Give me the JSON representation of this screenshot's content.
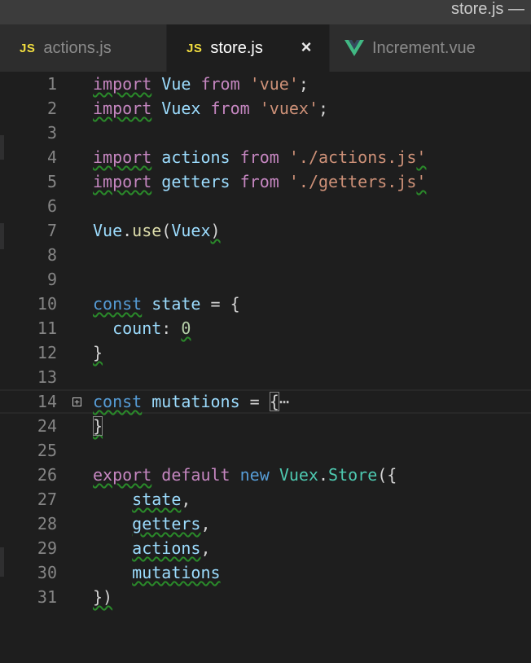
{
  "window": {
    "title": "store.js —"
  },
  "tabs": [
    {
      "icon": "js-file-icon",
      "icon_text": "JS",
      "label": "actions.js",
      "active": false
    },
    {
      "icon": "js-file-icon",
      "icon_text": "JS",
      "label": "store.js",
      "active": true,
      "close_glyph": "×"
    },
    {
      "icon": "vue-file-icon",
      "icon_text": "",
      "label": "Increment.vue",
      "active": false
    }
  ],
  "editor": {
    "fold_glyph": "+",
    "ellipsis": "⋯",
    "lines": [
      {
        "number": "1",
        "tokens": [
          [
            "import",
            "kw squig"
          ],
          [
            " ",
            ""
          ],
          [
            "Vue",
            "var"
          ],
          [
            " ",
            ""
          ],
          [
            "from",
            "kw"
          ],
          [
            " ",
            ""
          ],
          [
            "'vue'",
            "str"
          ],
          [
            ";",
            "punc"
          ]
        ]
      },
      {
        "number": "2",
        "tokens": [
          [
            "import",
            "kw squig"
          ],
          [
            " ",
            ""
          ],
          [
            "Vuex",
            "var"
          ],
          [
            " ",
            ""
          ],
          [
            "from",
            "kw"
          ],
          [
            " ",
            ""
          ],
          [
            "'vuex'",
            "str"
          ],
          [
            ";",
            "punc"
          ]
        ]
      },
      {
        "number": "3",
        "tokens": []
      },
      {
        "number": "4",
        "tokens": [
          [
            "import",
            "kw squig"
          ],
          [
            " ",
            ""
          ],
          [
            "actions",
            "var"
          ],
          [
            " ",
            ""
          ],
          [
            "from",
            "kw"
          ],
          [
            " ",
            ""
          ],
          [
            "'./actions.js",
            "str"
          ],
          [
            "'",
            "str squig"
          ]
        ]
      },
      {
        "number": "5",
        "tokens": [
          [
            "import",
            "kw squig"
          ],
          [
            " ",
            ""
          ],
          [
            "getters",
            "var"
          ],
          [
            " ",
            ""
          ],
          [
            "from",
            "kw"
          ],
          [
            " ",
            ""
          ],
          [
            "'./getters.js",
            "str"
          ],
          [
            "'",
            "str squig"
          ]
        ]
      },
      {
        "number": "6",
        "tokens": []
      },
      {
        "number": "7",
        "tokens": [
          [
            "Vue",
            "var"
          ],
          [
            ".",
            "punc"
          ],
          [
            "use",
            "fn"
          ],
          [
            "(",
            "punc"
          ],
          [
            "Vuex",
            "var"
          ],
          [
            ")",
            "punc squig"
          ]
        ]
      },
      {
        "number": "8",
        "tokens": []
      },
      {
        "number": "9",
        "tokens": []
      },
      {
        "number": "10",
        "tokens": [
          [
            "const",
            "kw-blue squig"
          ],
          [
            " ",
            ""
          ],
          [
            "state",
            "var"
          ],
          [
            " = {",
            "punc"
          ]
        ]
      },
      {
        "number": "11",
        "tokens": [
          [
            "  count",
            "var"
          ],
          [
            ": ",
            "punc"
          ],
          [
            "0",
            "num squig"
          ]
        ]
      },
      {
        "number": "12",
        "tokens": [
          [
            "}",
            "punc squig"
          ]
        ]
      },
      {
        "number": "13",
        "tokens": []
      },
      {
        "number": "14",
        "fold": true,
        "current": true,
        "tokens": [
          [
            "const",
            "kw-blue squig"
          ],
          [
            " ",
            ""
          ],
          [
            "mutations",
            "var"
          ],
          [
            " = ",
            "punc"
          ],
          [
            "{",
            "punc brace-box"
          ],
          [
            "⋯",
            "ellipsis"
          ]
        ]
      },
      {
        "number": "24",
        "tokens": [
          [
            "}",
            "punc brace-box squig"
          ]
        ]
      },
      {
        "number": "25",
        "tokens": []
      },
      {
        "number": "26",
        "tokens": [
          [
            "export",
            "kw squig"
          ],
          [
            " ",
            ""
          ],
          [
            "default",
            "kw"
          ],
          [
            " ",
            ""
          ],
          [
            "new",
            "kw-blue"
          ],
          [
            " ",
            ""
          ],
          [
            "Vuex",
            "cls"
          ],
          [
            ".",
            "punc"
          ],
          [
            "Store",
            "cls"
          ],
          [
            "({",
            "punc"
          ]
        ]
      },
      {
        "number": "27",
        "tokens": [
          [
            "    ",
            ""
          ],
          [
            "state",
            "var squig"
          ],
          [
            ",",
            "punc"
          ]
        ]
      },
      {
        "number": "28",
        "tokens": [
          [
            "    ",
            ""
          ],
          [
            "getters",
            "var squig"
          ],
          [
            ",",
            "punc"
          ]
        ]
      },
      {
        "number": "29",
        "tokens": [
          [
            "    ",
            ""
          ],
          [
            "actions",
            "var squig"
          ],
          [
            ",",
            "punc"
          ]
        ]
      },
      {
        "number": "30",
        "tokens": [
          [
            "    ",
            ""
          ],
          [
            "mutations",
            "var squig"
          ]
        ]
      },
      {
        "number": "31",
        "tokens": [
          [
            "})",
            "punc squig"
          ]
        ]
      }
    ]
  },
  "colors": {
    "background": "#1e1e1e",
    "keyword": "#c586c0",
    "keyword_blue": "#569cd6",
    "variable": "#9cdcfe",
    "function": "#dcdcaa",
    "string": "#ce9178",
    "number": "#b5cea8",
    "class": "#4ec9b0",
    "js_icon": "#f1dd3f",
    "vue_icon": "#41b883"
  }
}
